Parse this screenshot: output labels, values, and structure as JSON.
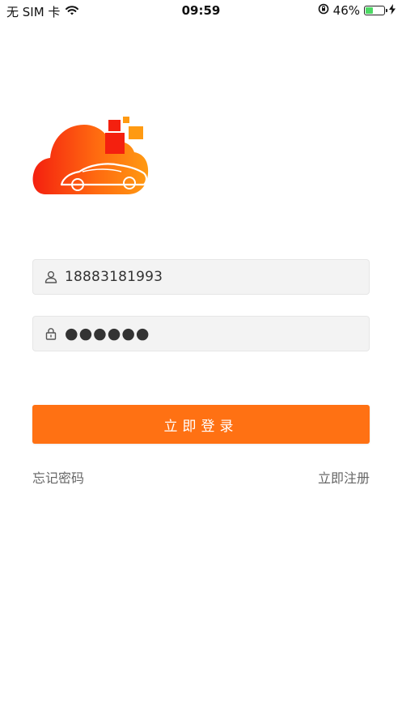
{
  "status_bar": {
    "carrier": "无 SIM 卡",
    "time": "09:59",
    "battery_percent_text": "46%",
    "battery_level": 0.46,
    "icons": [
      "wifi-icon",
      "orientation-lock-icon",
      "battery-icon",
      "charging-icon"
    ]
  },
  "login": {
    "phone_value": "18883181993",
    "password_mask": "●●●●●●",
    "login_button": "立即登录",
    "forgot_password": "忘记密码",
    "register": "立即注册"
  },
  "colors": {
    "accent": "#ff7113",
    "field_bg": "#f3f3f3",
    "logo_red": "#f4200f",
    "logo_orange": "#ff9a12"
  }
}
